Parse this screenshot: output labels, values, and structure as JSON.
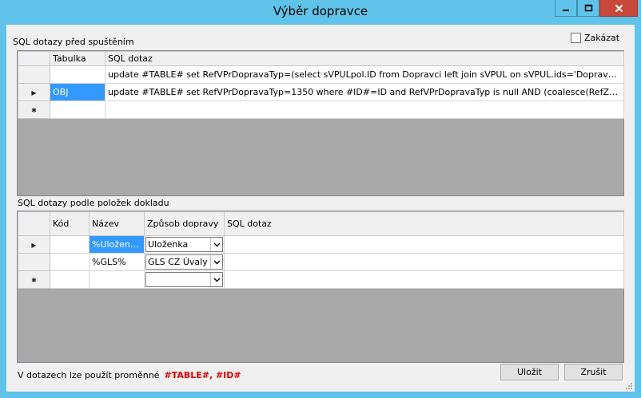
{
  "window": {
    "title": "Výběr dopravce",
    "controls": [
      "minimize",
      "maximize",
      "close"
    ]
  },
  "top_section": {
    "label": "SQL dotazy před spuštěním",
    "disable_checkbox": {
      "label": "Zakázat",
      "checked": false
    },
    "columns": {
      "table": "Tabulka",
      "query": "SQL dotaz"
    },
    "rows": [
      {
        "table": "",
        "query": "update #TABLE# set RefVPrDopravaTyp=(select sVPULpol.ID from Dopravci left join sVPUL on sVPUL.ids='DopravaTyp' left join sV..."
      },
      {
        "table": "OBJ",
        "query": "update #TABLE# set RefVPrDopravaTyp=1350 where #ID#=ID and RefVPrDopravaTyp is null AND (coalesce(RefZeme2,RefZeme,..."
      }
    ]
  },
  "bottom_section": {
    "label": "SQL dotazy podle položek dokladu",
    "columns": {
      "code": "Kód",
      "name": "Název",
      "method": "Způsob dopravy",
      "query": "SQL dotaz"
    },
    "rows": [
      {
        "code": "",
        "name": "%Uloženka%",
        "method": "Uloženka",
        "query": ""
      },
      {
        "code": "",
        "name": "%GLS%",
        "method": "GLS CZ Úvaly",
        "query": ""
      },
      {
        "code": "",
        "name": "",
        "method": "",
        "query": ""
      }
    ]
  },
  "footer": {
    "vars_text": "V dotazech lze použít proměnné",
    "vars_highlight": "#TABLE#, #ID#",
    "save_label": "Uložit",
    "cancel_label": "Zrušit"
  },
  "colors": {
    "titlebar": "#5fc3ea",
    "close_button": "#c7473a",
    "selection": "#3399ff",
    "highlight_text": "#e30000"
  }
}
